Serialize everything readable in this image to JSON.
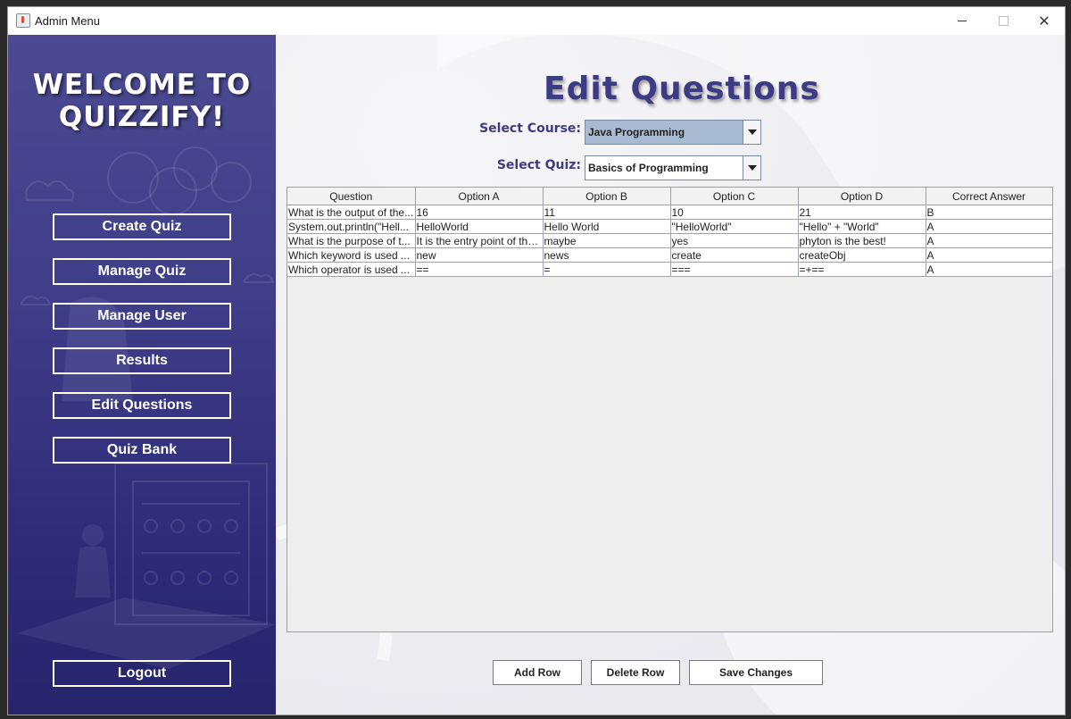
{
  "window": {
    "title": "Admin Menu"
  },
  "sidebar": {
    "welcome_line1": "WELCOME TO",
    "welcome_line2": "QUIZZIFY!",
    "items": [
      {
        "label": "Create Quiz"
      },
      {
        "label": "Manage Quiz"
      },
      {
        "label": "Manage User"
      },
      {
        "label": "Results"
      },
      {
        "label": "Edit Questions"
      },
      {
        "label": "Quiz Bank"
      }
    ],
    "logout_label": "Logout"
  },
  "main": {
    "title": "Edit Questions",
    "course_label": "Select Course:",
    "course_value": "Java Programming",
    "quiz_label": "Select Quiz:",
    "quiz_value": "Basics of Programming"
  },
  "table": {
    "columns": [
      "Question",
      "Option A",
      "Option B",
      "Option C",
      "Option D",
      "Correct Answer"
    ],
    "rows": [
      [
        "What is the output of the...",
        "16",
        "11",
        "10",
        "21",
        "B"
      ],
      [
        "System.out.println(\"Hell...",
        "HelloWorld",
        "Hello World",
        "\"HelloWorld\"",
        "\"Hello\" + \"World\"",
        "A"
      ],
      [
        "What is the purpose of t...",
        "It is the entry point of the...",
        "maybe",
        "yes",
        "phyton is the best!",
        "A"
      ],
      [
        "Which keyword is used ...",
        "new",
        "news",
        "create",
        "createObj",
        "A"
      ],
      [
        "Which operator is used ...",
        "==",
        "=",
        "===",
        "=+==",
        "A"
      ]
    ]
  },
  "actions": {
    "add_row": "Add Row",
    "delete_row": "Delete Row",
    "save_changes": "Save Changes"
  },
  "colors": {
    "sidebar_top": "#4b4a92",
    "sidebar_bottom": "#25246c",
    "title_color": "#3c3b83"
  }
}
